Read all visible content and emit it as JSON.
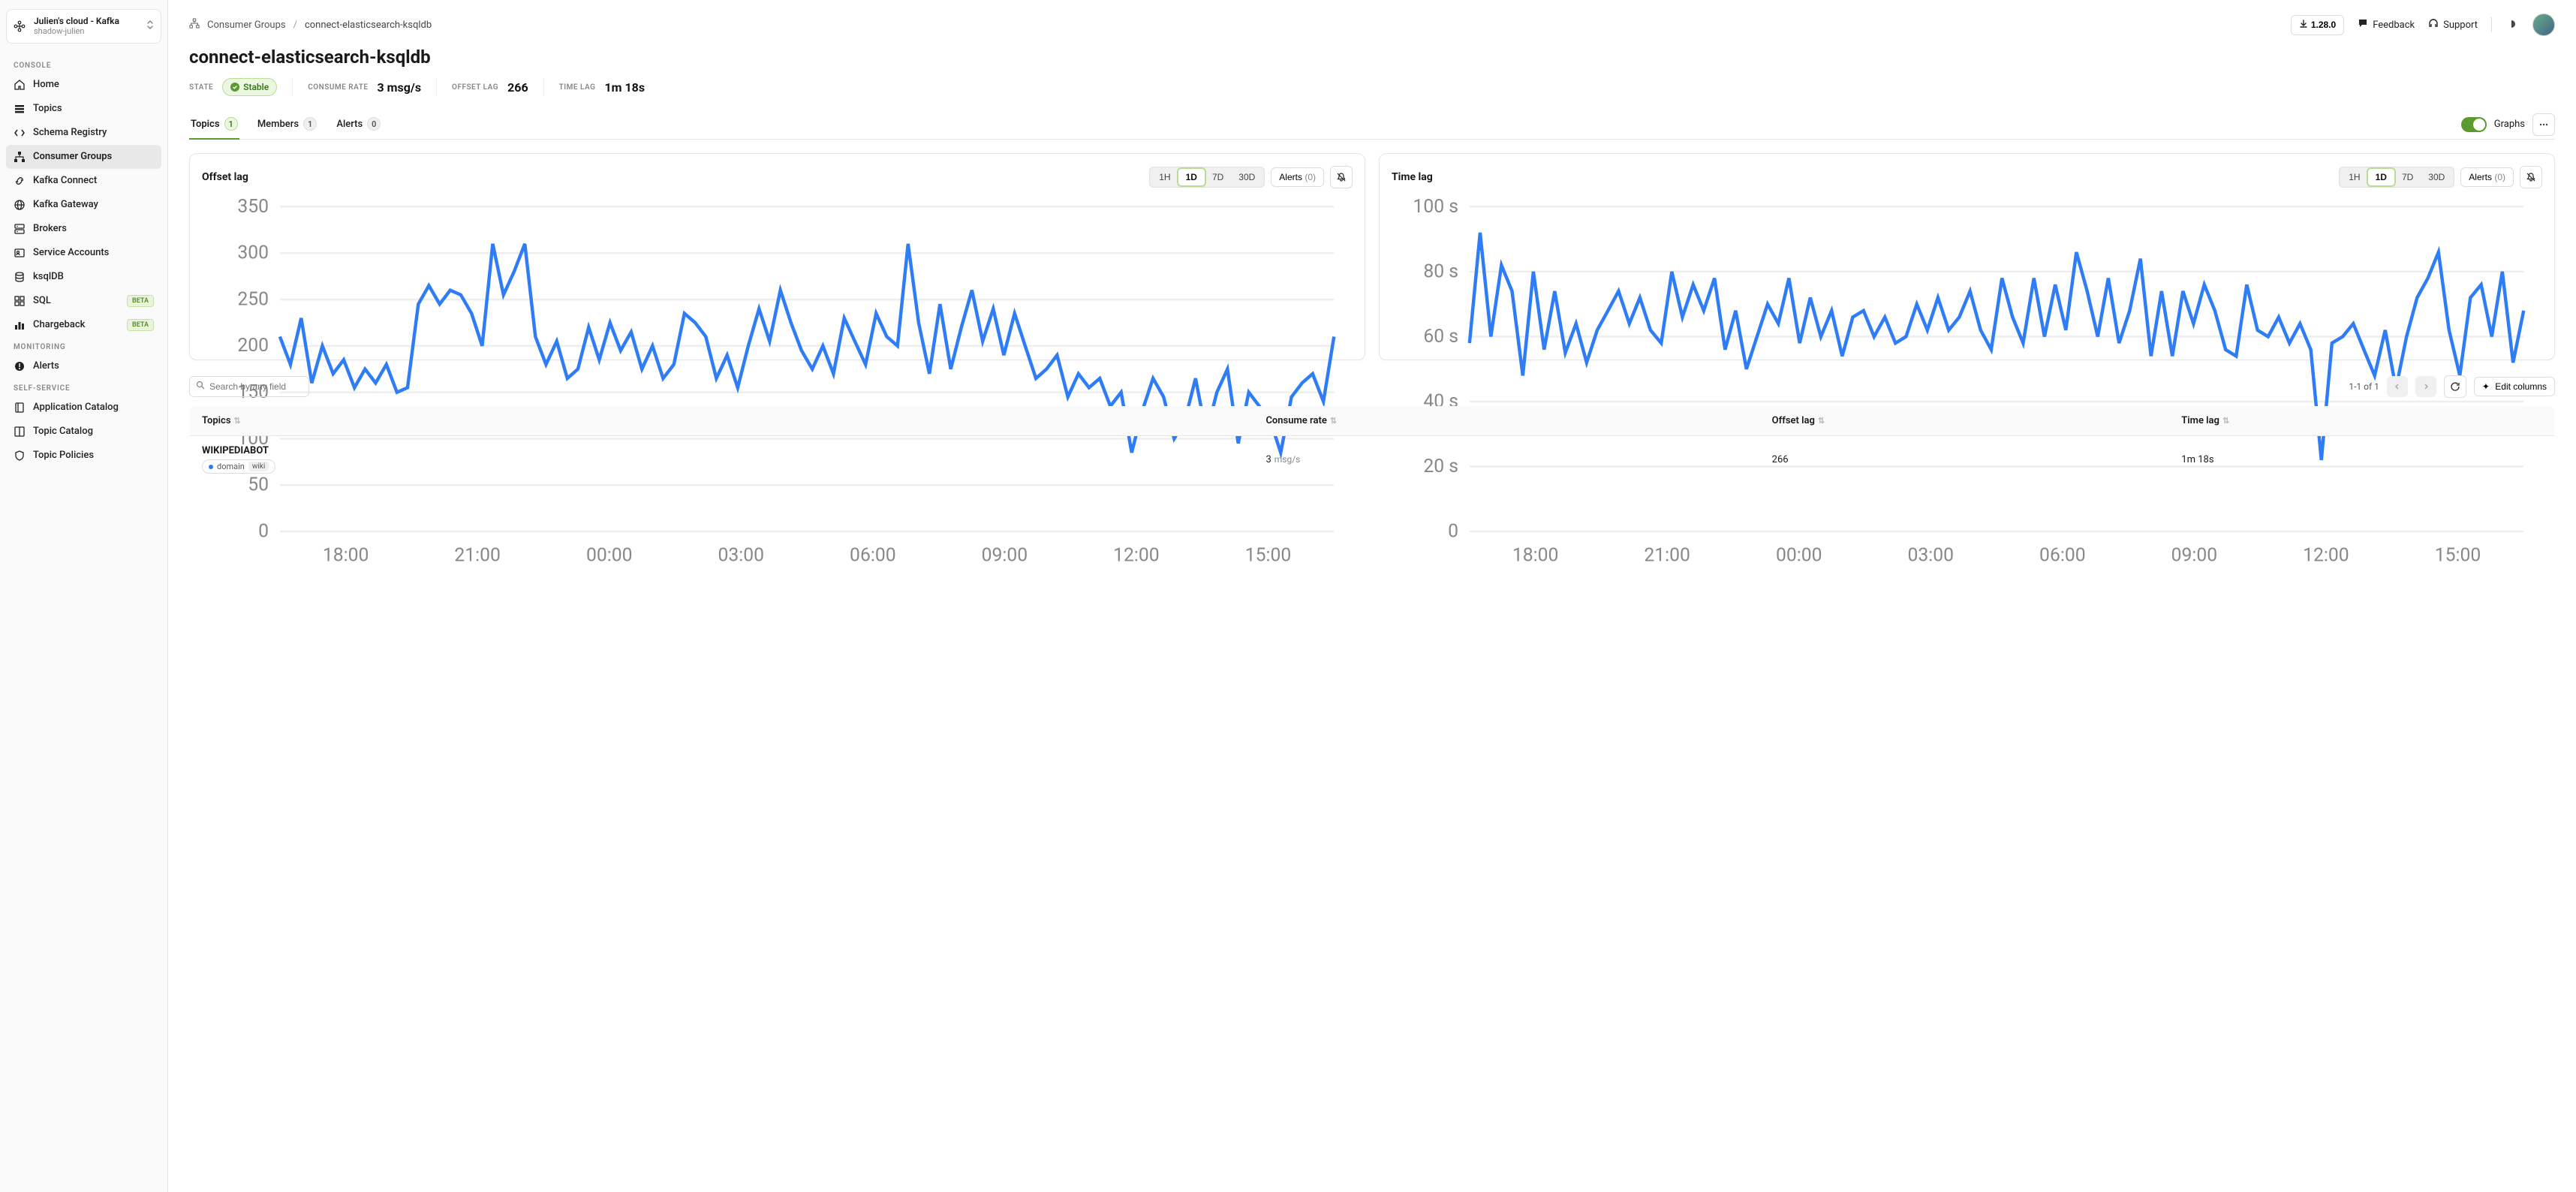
{
  "cluster": {
    "name": "Julien's cloud - Kafka",
    "sub": "shadow-julien"
  },
  "sidebar": {
    "sections": [
      {
        "label": "CONSOLE",
        "items": [
          {
            "id": "home",
            "label": "Home",
            "icon": "home"
          },
          {
            "id": "topics",
            "label": "Topics",
            "icon": "layers"
          },
          {
            "id": "schema",
            "label": "Schema Registry",
            "icon": "code"
          },
          {
            "id": "consumer-groups",
            "label": "Consumer Groups",
            "icon": "sitemap",
            "active": true
          },
          {
            "id": "kafka-connect",
            "label": "Kafka Connect",
            "icon": "link"
          },
          {
            "id": "kafka-gateway",
            "label": "Kafka Gateway",
            "icon": "globe"
          },
          {
            "id": "brokers",
            "label": "Brokers",
            "icon": "server"
          },
          {
            "id": "service-accounts",
            "label": "Service Accounts",
            "icon": "badge"
          },
          {
            "id": "ksqldb",
            "label": "ksqlDB",
            "icon": "db"
          },
          {
            "id": "sql",
            "label": "SQL",
            "icon": "grid",
            "beta": true
          },
          {
            "id": "chargeback",
            "label": "Chargeback",
            "icon": "bars",
            "beta": true
          }
        ]
      },
      {
        "label": "MONITORING",
        "items": [
          {
            "id": "alerts",
            "label": "Alerts",
            "icon": "alert"
          }
        ]
      },
      {
        "label": "SELF-SERVICE",
        "items": [
          {
            "id": "app-catalog",
            "label": "Application Catalog",
            "icon": "book"
          },
          {
            "id": "topic-catalog",
            "label": "Topic Catalog",
            "icon": "columns"
          },
          {
            "id": "topic-policies",
            "label": "Topic Policies",
            "icon": "shield"
          }
        ]
      }
    ]
  },
  "beta_label": "BETA",
  "top": {
    "breadcrumb": {
      "root": "Consumer Groups",
      "current": "connect-elasticsearch-ksqldb"
    },
    "version": "1.28.0",
    "feedback": "Feedback",
    "support": "Support"
  },
  "page": {
    "title": "connect-elasticsearch-ksqldb",
    "stats": {
      "state_label": "STATE",
      "state_value": "Stable",
      "consume_label": "CONSUME RATE",
      "consume_value": "3 msg/s",
      "offset_label": "OFFSET LAG",
      "offset_value": "266",
      "time_label": "TIME LAG",
      "time_value": "1m 18s"
    },
    "tabs": [
      {
        "id": "topics",
        "label": "Topics",
        "count": "1",
        "active": true
      },
      {
        "id": "members",
        "label": "Members",
        "count": "1"
      },
      {
        "id": "alerts",
        "label": "Alerts",
        "count": "0"
      }
    ],
    "graphs_label": "Graphs"
  },
  "charts": {
    "ranges": [
      "1H",
      "1D",
      "7D",
      "30D"
    ],
    "active_range": "1D",
    "alerts_label": "Alerts",
    "alerts_count": "(0)",
    "offset": {
      "title": "Offset lag"
    },
    "time": {
      "title": "Time lag"
    }
  },
  "chart_data": [
    {
      "type": "line",
      "title": "Offset lag",
      "xlabel": "",
      "ylabel": "",
      "ylim": [
        0,
        350
      ],
      "yticks": [
        0,
        50,
        100,
        150,
        200,
        250,
        300,
        350
      ],
      "xticks": [
        "18:00",
        "21:00",
        "00:00",
        "03:00",
        "06:00",
        "09:00",
        "12:00",
        "15:00"
      ],
      "x": [
        0,
        1,
        2,
        3,
        4,
        5,
        6,
        7,
        8,
        9,
        10,
        11,
        12,
        13,
        14,
        15,
        16,
        17,
        18,
        19,
        20,
        21,
        22,
        23,
        24,
        25,
        26,
        27,
        28,
        29,
        30,
        31,
        32,
        33,
        34,
        35,
        36,
        37,
        38,
        39,
        40,
        41,
        42,
        43,
        44,
        45,
        46,
        47,
        48,
        49,
        50,
        51,
        52,
        53,
        54,
        55,
        56,
        57,
        58,
        59,
        60,
        61,
        62,
        63,
        64,
        65,
        66,
        67,
        68,
        69,
        70,
        71,
        72,
        73,
        74,
        75,
        76,
        77,
        78,
        79,
        80,
        81,
        82,
        83,
        84,
        85,
        86,
        87,
        88,
        89,
        90,
        91,
        92,
        93,
        94,
        95,
        96,
        97,
        98,
        99
      ],
      "values": [
        210,
        180,
        230,
        160,
        200,
        170,
        185,
        155,
        175,
        160,
        180,
        150,
        155,
        245,
        265,
        245,
        260,
        255,
        235,
        200,
        310,
        255,
        280,
        310,
        210,
        180,
        205,
        165,
        175,
        220,
        185,
        225,
        195,
        215,
        175,
        200,
        165,
        180,
        235,
        225,
        210,
        165,
        190,
        155,
        200,
        240,
        205,
        260,
        225,
        195,
        175,
        200,
        170,
        230,
        205,
        180,
        235,
        210,
        200,
        310,
        225,
        170,
        245,
        175,
        220,
        260,
        205,
        240,
        190,
        235,
        200,
        165,
        175,
        190,
        145,
        170,
        155,
        165,
        135,
        150,
        85,
        130,
        165,
        145,
        100,
        120,
        165,
        105,
        150,
        175,
        95,
        150,
        135,
        120,
        85,
        145,
        160,
        170,
        140,
        210
      ]
    },
    {
      "type": "line",
      "title": "Time lag",
      "xlabel": "",
      "ylabel": "",
      "ylim": [
        0,
        100
      ],
      "yticks": [
        0,
        20,
        40,
        60,
        80,
        100
      ],
      "ytick_labels": [
        "0",
        "20 s",
        "40 s",
        "60 s",
        "80 s",
        "100 s"
      ],
      "xticks": [
        "18:00",
        "21:00",
        "00:00",
        "03:00",
        "06:00",
        "09:00",
        "12:00",
        "15:00"
      ],
      "x": [
        0,
        1,
        2,
        3,
        4,
        5,
        6,
        7,
        8,
        9,
        10,
        11,
        12,
        13,
        14,
        15,
        16,
        17,
        18,
        19,
        20,
        21,
        22,
        23,
        24,
        25,
        26,
        27,
        28,
        29,
        30,
        31,
        32,
        33,
        34,
        35,
        36,
        37,
        38,
        39,
        40,
        41,
        42,
        43,
        44,
        45,
        46,
        47,
        48,
        49,
        50,
        51,
        52,
        53,
        54,
        55,
        56,
        57,
        58,
        59,
        60,
        61,
        62,
        63,
        64,
        65,
        66,
        67,
        68,
        69,
        70,
        71,
        72,
        73,
        74,
        75,
        76,
        77,
        78,
        79,
        80,
        81,
        82,
        83,
        84,
        85,
        86,
        87,
        88,
        89,
        90,
        91,
        92,
        93,
        94,
        95,
        96,
        97,
        98,
        99
      ],
      "values": [
        58,
        92,
        60,
        82,
        74,
        48,
        80,
        56,
        74,
        55,
        64,
        52,
        62,
        68,
        74,
        64,
        72,
        62,
        58,
        80,
        66,
        76,
        68,
        78,
        56,
        68,
        50,
        60,
        70,
        64,
        78,
        58,
        72,
        60,
        68,
        54,
        66,
        68,
        60,
        66,
        58,
        60,
        70,
        62,
        72,
        62,
        66,
        74,
        62,
        56,
        78,
        66,
        58,
        78,
        60,
        76,
        62,
        86,
        74,
        60,
        78,
        58,
        68,
        84,
        54,
        74,
        54,
        74,
        64,
        76,
        68,
        56,
        54,
        76,
        62,
        60,
        66,
        58,
        64,
        56,
        22,
        58,
        60,
        64,
        56,
        48,
        62,
        44,
        60,
        72,
        78,
        86,
        62,
        48,
        72,
        76,
        60,
        80,
        52,
        68
      ]
    }
  ],
  "table": {
    "search_placeholder": "Search by any field",
    "pager": "1-1 of 1",
    "edit_columns": "Edit columns",
    "headers": [
      "Topics",
      "Consume rate",
      "Offset lag",
      "Time lag"
    ],
    "rows": [
      {
        "topic": "WIKIPEDIABOT",
        "tag_key": "domain",
        "tag_val": "wiki",
        "rate_num": "3",
        "rate_unit": "msg/s",
        "offset": "266",
        "time": "1m 18s"
      }
    ]
  }
}
